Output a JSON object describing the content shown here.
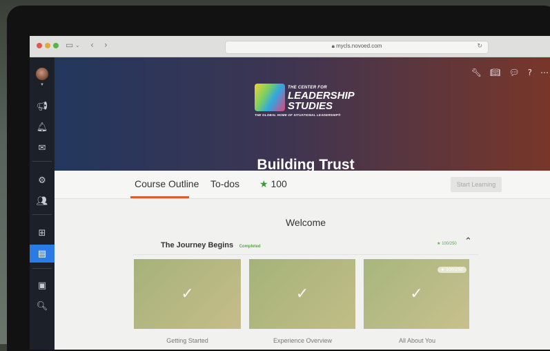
{
  "browser": {
    "url": "mycls.novoed.com",
    "lock_icon": "lock-icon",
    "reload_icon": "reload-icon"
  },
  "rail": {
    "items": [
      "megaphone-icon",
      "bell-icon",
      "mail-icon",
      "gear-search-icon",
      "people-icon",
      "grid-icon",
      "course-icon",
      "calendar-icon",
      "search-icon"
    ]
  },
  "hero": {
    "logo_line1": "THE CENTER FOR",
    "logo_line2": "LEADERSHIP",
    "logo_line3": "STUDIES",
    "logo_tagline": "THE GLOBAL HOME OF SITUATIONAL LEADERSHIP®",
    "title": "Building Trust",
    "tools": [
      "wrench-icon",
      "book-icon",
      "comments-icon",
      "help-icon",
      "more-icon"
    ]
  },
  "tabs": {
    "course_outline": "Course Outline",
    "todos": "To-dos",
    "points": "100",
    "start_learning": "Start Learning"
  },
  "content": {
    "welcome": "Welcome",
    "section_title": "The Journey Begins",
    "section_status": "Completed",
    "section_points": "100/250",
    "cards": [
      {
        "label": "Getting Started"
      },
      {
        "label": "Experience Overview"
      },
      {
        "label": "All About You",
        "points": "100/250"
      }
    ]
  },
  "colors": {
    "accent": "#e05b2b",
    "active_rail": "#2b7be5",
    "success": "#56a83f"
  }
}
